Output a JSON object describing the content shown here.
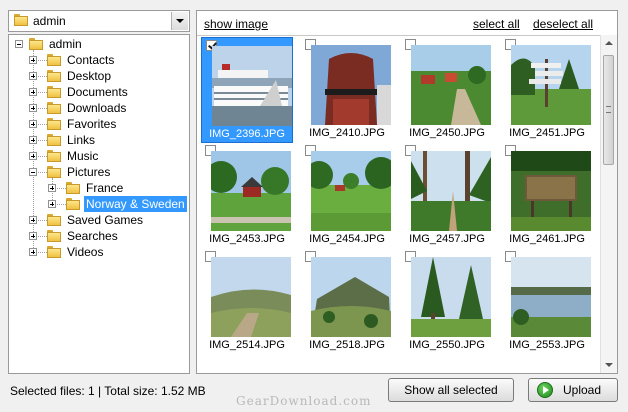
{
  "folder_select": {
    "value": "admin"
  },
  "tree": {
    "root": "admin",
    "items": [
      {
        "label": "Contacts",
        "expand": "plus",
        "selected": false,
        "level": 1
      },
      {
        "label": "Desktop",
        "expand": "plus",
        "selected": false,
        "level": 1
      },
      {
        "label": "Documents",
        "expand": "plus",
        "selected": false,
        "level": 1
      },
      {
        "label": "Downloads",
        "expand": "plus",
        "selected": false,
        "level": 1
      },
      {
        "label": "Favorites",
        "expand": "plus",
        "selected": false,
        "level": 1
      },
      {
        "label": "Links",
        "expand": "plus",
        "selected": false,
        "level": 1
      },
      {
        "label": "Music",
        "expand": "plus",
        "selected": false,
        "level": 1
      },
      {
        "label": "Pictures",
        "expand": "minus",
        "selected": false,
        "level": 1
      },
      {
        "label": "France",
        "expand": "plus",
        "selected": false,
        "level": 2
      },
      {
        "label": "Norway & Sweden",
        "expand": "plus",
        "selected": true,
        "level": 2
      },
      {
        "label": "Saved Games",
        "expand": "plus",
        "selected": false,
        "level": 1
      },
      {
        "label": "Searches",
        "expand": "plus",
        "selected": false,
        "level": 1
      },
      {
        "label": "Videos",
        "expand": "plus",
        "selected": false,
        "level": 1
      }
    ]
  },
  "gallery": {
    "show_image": "show image",
    "select_all": "select all",
    "deselect_all": "deselect all",
    "images": [
      {
        "name": "IMG_2396.JPG",
        "checked": true,
        "selected": true,
        "scene": "ship"
      },
      {
        "name": "IMG_2410.JPG",
        "checked": false,
        "selected": false,
        "scene": "hull"
      },
      {
        "name": "IMG_2450.JPG",
        "checked": false,
        "selected": false,
        "scene": "village"
      },
      {
        "name": "IMG_2451.JPG",
        "checked": false,
        "selected": false,
        "scene": "signpost"
      },
      {
        "name": "IMG_2453.JPG",
        "checked": false,
        "selected": false,
        "scene": "house"
      },
      {
        "name": "IMG_2454.JPG",
        "checked": false,
        "selected": false,
        "scene": "meadow"
      },
      {
        "name": "IMG_2457.JPG",
        "checked": false,
        "selected": false,
        "scene": "forest"
      },
      {
        "name": "IMG_2461.JPG",
        "checked": false,
        "selected": false,
        "scene": "board"
      },
      {
        "name": "IMG_2514.JPG",
        "checked": false,
        "selected": false,
        "scene": "hills"
      },
      {
        "name": "IMG_2518.JPG",
        "checked": false,
        "selected": false,
        "scene": "mountain"
      },
      {
        "name": "IMG_2550.JPG",
        "checked": false,
        "selected": false,
        "scene": "pines"
      },
      {
        "name": "IMG_2553.JPG",
        "checked": false,
        "selected": false,
        "scene": "lake"
      }
    ]
  },
  "status": {
    "text": "Selected files: 1 | Total size: 1.52 MB"
  },
  "buttons": {
    "show_all_selected": "Show all selected",
    "upload": "Upload"
  },
  "watermark": "GearDownload.com",
  "colors": {
    "selection": "#3399ff",
    "upload_icon": "#2e9e2e"
  }
}
